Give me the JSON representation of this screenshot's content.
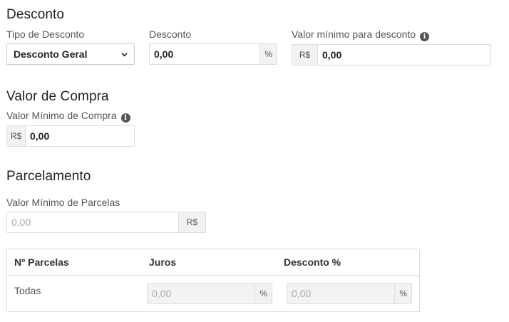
{
  "desconto": {
    "title": "Desconto",
    "tipo_label": "Tipo de Desconto",
    "tipo_value": "Desconto Geral",
    "desconto_label": "Desconto",
    "desconto_value": "0,00",
    "desconto_unit": "%",
    "valor_minimo_label": "Valor mínimo para desconto",
    "valor_minimo_currency": "R$",
    "valor_minimo_value": "0,00"
  },
  "compra": {
    "title": "Valor de Compra",
    "minimo_label": "Valor Mínimo de Compra",
    "minimo_currency": "R$",
    "minimo_value": "0,00"
  },
  "parcelamento": {
    "title": "Parcelamento",
    "minimo_parcelas_label": "Valor Mínimo de Parcelas",
    "minimo_parcelas_placeholder": "0,00",
    "minimo_parcelas_currency": "R$",
    "table": {
      "headers": [
        "Nº Parcelas",
        "Juros",
        "Desconto %"
      ],
      "rows": [
        {
          "parcelas": "Todas",
          "juros": "0,00",
          "juros_unit": "%",
          "desconto": "0,00",
          "desconto_unit": "%"
        }
      ]
    }
  }
}
